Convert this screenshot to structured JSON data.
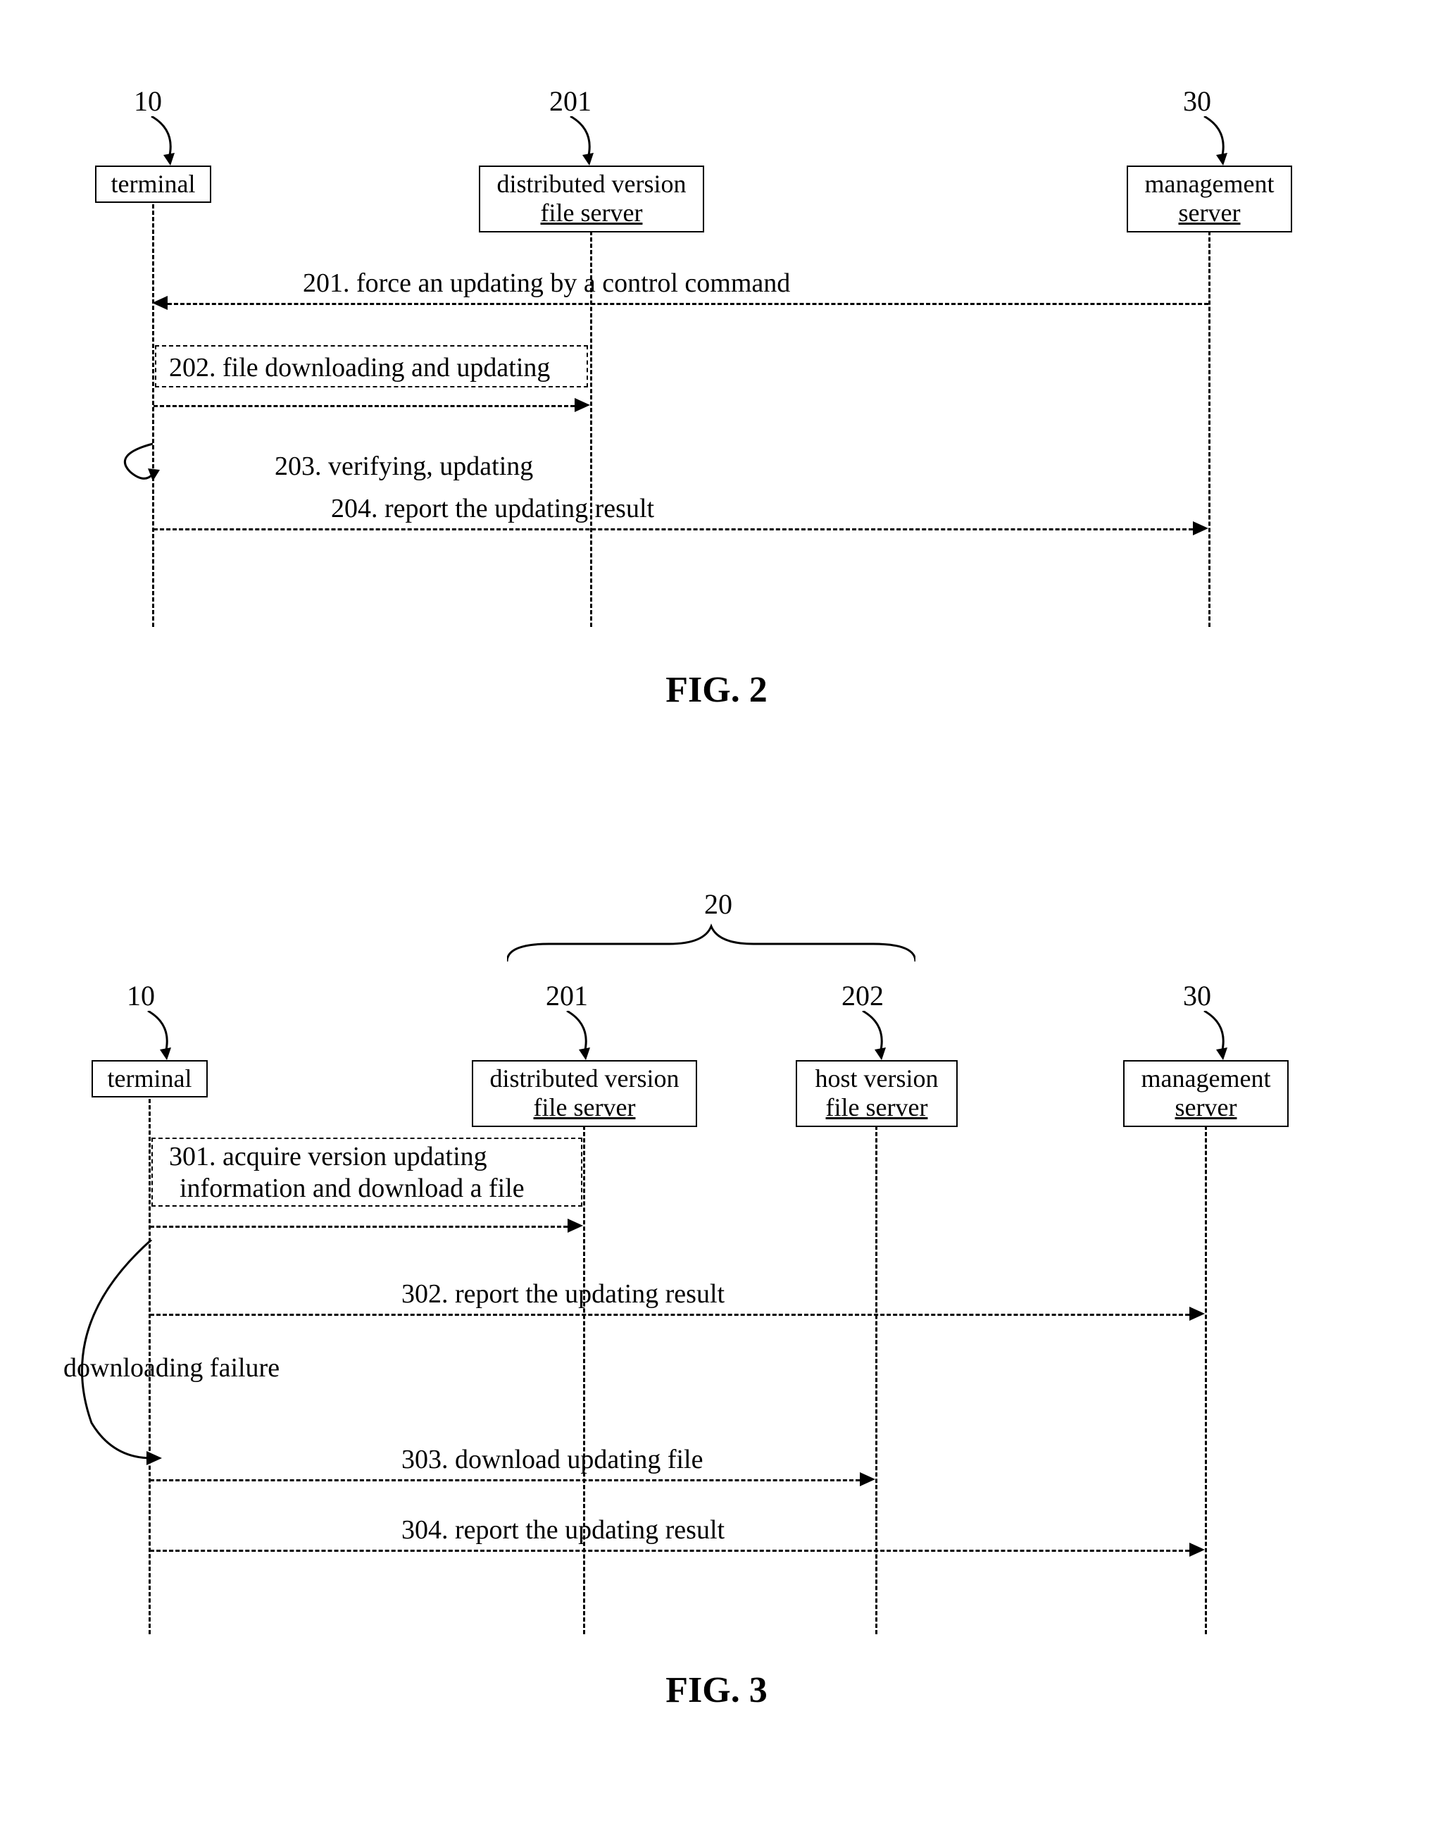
{
  "fig2": {
    "caption": "FIG. 2",
    "participants": {
      "terminal": {
        "num": "10",
        "label": "terminal"
      },
      "dvfs": {
        "num": "201",
        "label1": "distributed version",
        "label2": "file server"
      },
      "mgmt": {
        "num": "30",
        "label1": "management",
        "label2": "server"
      }
    },
    "messages": {
      "m201": "201. force an updating by a control command",
      "m202": "202. file downloading and updating",
      "m203": "203. verifying, updating",
      "m204": "204. report the updating result"
    }
  },
  "fig3": {
    "caption": "FIG. 3",
    "brace_num": "20",
    "participants": {
      "terminal": {
        "num": "10",
        "label": "terminal"
      },
      "dvfs": {
        "num": "201",
        "label1": "distributed version",
        "label2": "file server"
      },
      "hvfs": {
        "num": "202",
        "label1": "host version",
        "label2": "file server"
      },
      "mgmt": {
        "num": "30",
        "label1": "management",
        "label2": "server"
      }
    },
    "messages": {
      "m301a": "301. acquire version updating",
      "m301b": "information and download a file",
      "m302": "302. report the updating result",
      "dfail": "downloading failure",
      "m303": "303. download updating file",
      "m304": "304. report the updating result"
    }
  }
}
